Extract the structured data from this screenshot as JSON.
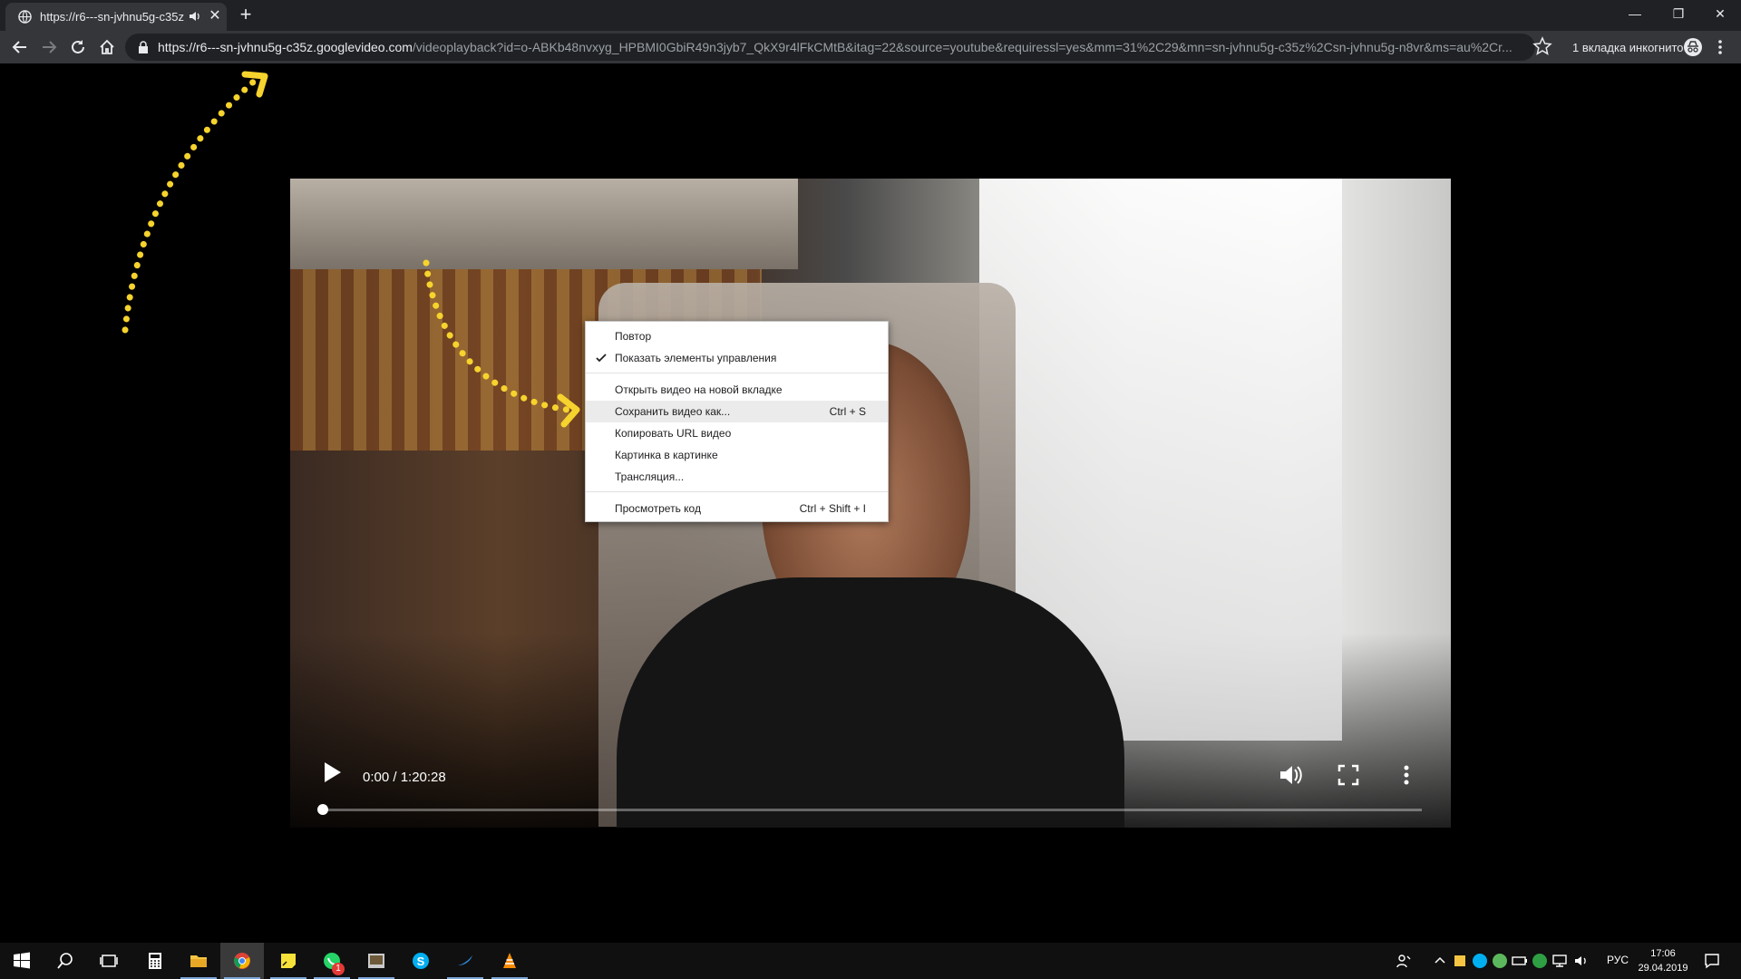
{
  "browser": {
    "tab_title": "https://r6---sn-jvhnu5g-c35z",
    "tab_close": "✕",
    "new_tab": "+",
    "window_controls": {
      "minimize": "—",
      "restore": "❐",
      "close": "✕"
    },
    "url_host": "https://r6---sn-jvhnu5g-c35z.googlevideo.com",
    "url_path": "/videoplayback?id=o-ABKb48nvxyg_HPBMI0GbiR49n3jyb7_QkX9r4lFkCMtB&itag=22&source=youtube&requiressl=yes&mm=31%2C29&mn=sn-jvhnu5g-c35z%2Csn-jvhnu5g-n8vr&ms=au%2Cr...",
    "incognito_text": "1 вкладка инкогнито"
  },
  "player": {
    "time": "0:00 / 1:20:28",
    "progress": 0
  },
  "context_menu": {
    "items": [
      {
        "label": "Повтор",
        "shortcut": ""
      },
      {
        "label": "Показать элементы управления",
        "shortcut": "",
        "checked": true
      },
      {
        "label": "Открыть видео на новой вкладке",
        "shortcut": ""
      },
      {
        "label": "Сохранить видео как...",
        "shortcut": "Ctrl + S",
        "highlighted": true
      },
      {
        "label": "Копировать URL видео",
        "shortcut": ""
      },
      {
        "label": "Картинка в картинке",
        "shortcut": ""
      },
      {
        "label": "Трансляция...",
        "shortcut": ""
      },
      {
        "label": "Просмотреть код",
        "shortcut": "Ctrl + Shift + I"
      }
    ]
  },
  "taskbar": {
    "lang": "РУС",
    "time": "17:06",
    "date": "29.04.2019",
    "whatsapp_badge": "1"
  },
  "colors": {
    "annotation_arrow": "#f6d32d",
    "taskbar_accent": "#7da7d9"
  }
}
